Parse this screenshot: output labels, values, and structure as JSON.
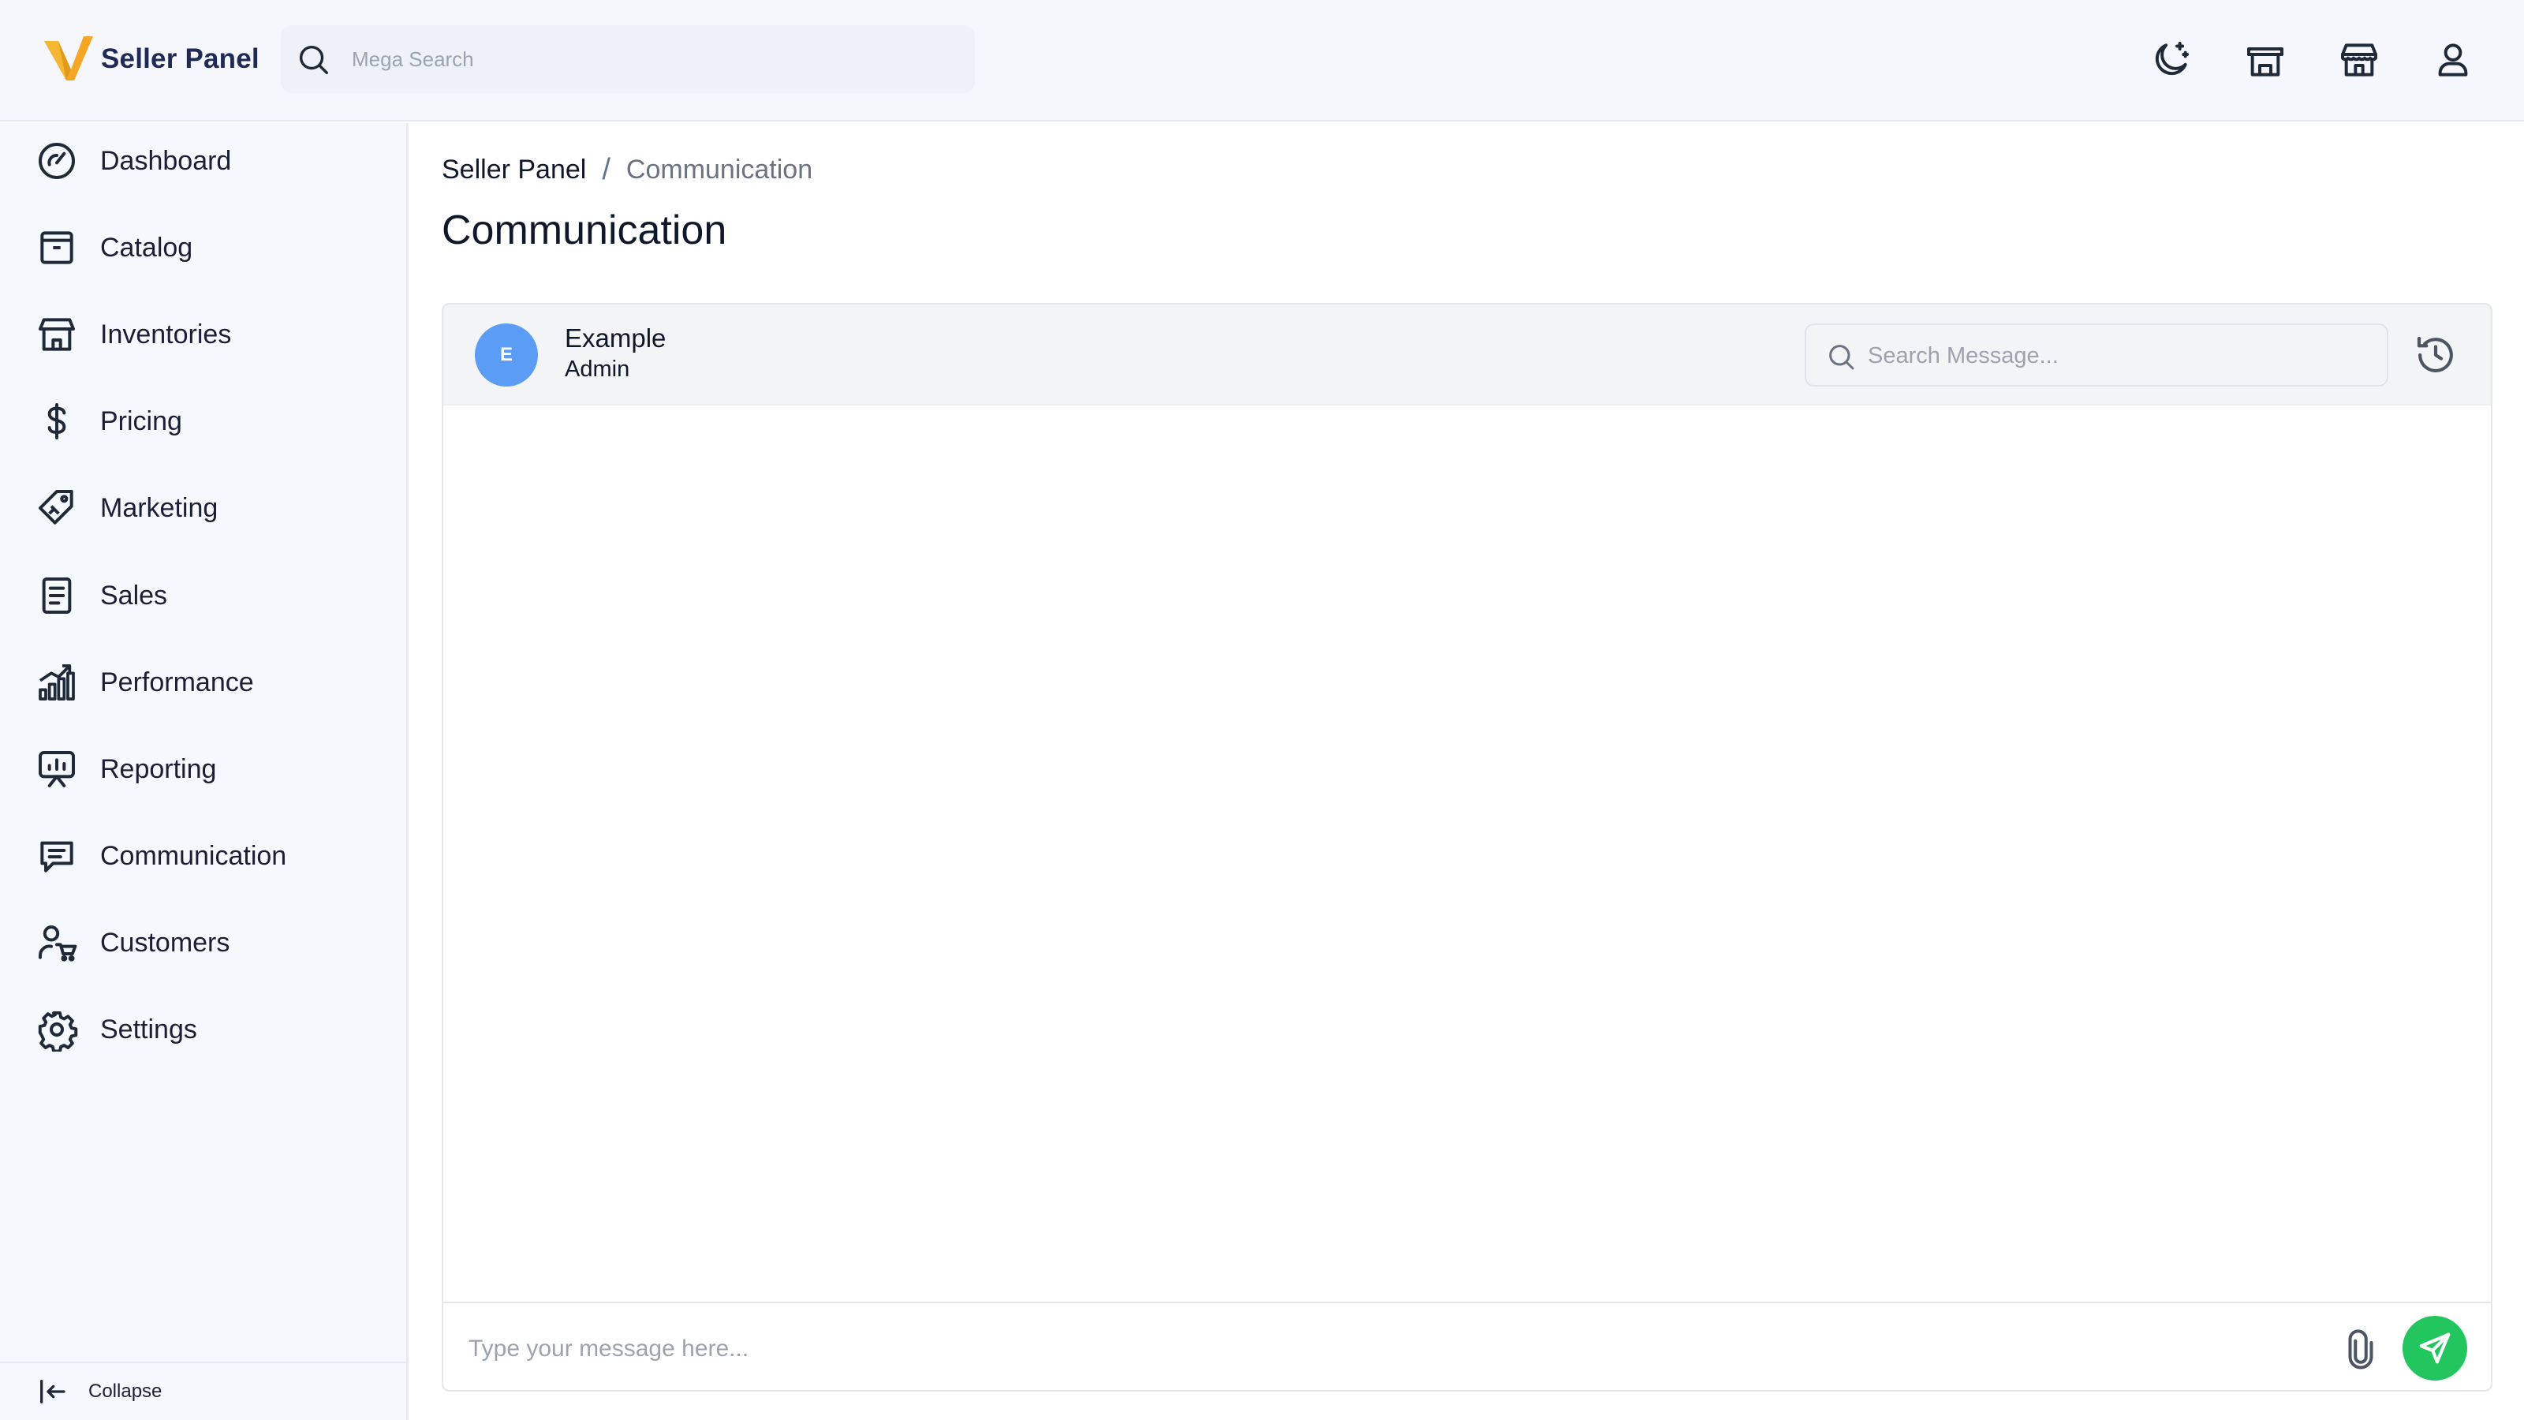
{
  "app": {
    "brand": "Seller Panel"
  },
  "header": {
    "search_placeholder": "Mega Search",
    "icons": [
      "moon-icon",
      "store-icon",
      "warehouse-icon",
      "user-icon"
    ]
  },
  "sidebar": {
    "items": [
      {
        "label": "Dashboard",
        "icon": "gauge-icon"
      },
      {
        "label": "Catalog",
        "icon": "archive-box-icon"
      },
      {
        "label": "Inventories",
        "icon": "warehouse-icon"
      },
      {
        "label": "Pricing",
        "icon": "dollar-icon"
      },
      {
        "label": "Marketing",
        "icon": "tag-icon"
      },
      {
        "label": "Sales",
        "icon": "document-list-icon"
      },
      {
        "label": "Performance",
        "icon": "bar-chart-icon"
      },
      {
        "label": "Reporting",
        "icon": "presentation-icon"
      },
      {
        "label": "Communication",
        "icon": "message-icon"
      },
      {
        "label": "Customers",
        "icon": "user-cart-icon"
      },
      {
        "label": "Settings",
        "icon": "gear-icon"
      }
    ],
    "collapse_label": "Collapse"
  },
  "main": {
    "breadcrumb": {
      "root": "Seller Panel",
      "separator": "/",
      "current": "Communication"
    },
    "title": "Communication",
    "chat": {
      "contact": {
        "initial": "E",
        "name": "Example",
        "role": "Admin",
        "avatar_color": "#5b9cf5"
      },
      "search_placeholder": "Search Message...",
      "composer_placeholder": "Type your message here...",
      "send_color": "#22c55e"
    }
  }
}
